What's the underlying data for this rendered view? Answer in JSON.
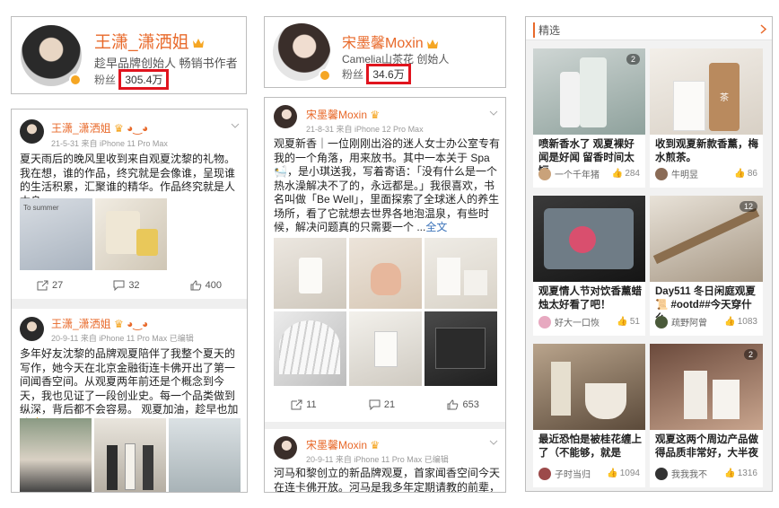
{
  "col1": {
    "profile": {
      "name": "王潇_潇洒姐",
      "subtitle": "趁早品牌创始人 畅销书作者",
      "fans_label": "粉丝",
      "fans_count": "305.4万"
    },
    "posts": [
      {
        "name": "王潇_潇洒姐",
        "meta": "21-5-31  来自 iPhone 11 Pro Max",
        "text": "夏天雨后的晚风里收到来自观夏沈黎的礼物。我在想，谁的作品，终究就是会像谁，呈现谁的生活积累，汇聚谁的精华。作品终究就是人本身。",
        "img_label": "To summer",
        "reposts": "27",
        "comments": "32",
        "likes": "400"
      },
      {
        "name": "王潇_潇洒姐",
        "meta": "20-9-11  来自 iPhone 11 Pro Max  已编辑",
        "text": "多年好友沈黎的品牌观夏陪伴了我整个夏天的写作，她今天在北京金融街连卡佛开出了第一间闻香空间。从观夏两年前还是个概念到今天，我也见证了一段创业史。每一个品类做到纵深，背后都不会容易。 观夏加油，趁早也加油🔆"
      }
    ]
  },
  "col2": {
    "profile": {
      "name": "宋墨馨Moxin",
      "subtitle": "Camelia山茶花 创始人",
      "fans_label": "粉丝",
      "fans_count": "34.6万"
    },
    "posts": [
      {
        "name": "宋墨馨Moxin",
        "meta": "21-8-31  来自 iPhone 12 Pro Max",
        "text": "观夏新香｜一位刚刚出浴的迷人女士办公室专有我的一个角落，用来放书。其中一本关于 Spa 🛀，是小琪送我，写着寄语：「没有什么是一个热水澡解决不了的，永远都是。」我很喜欢，书名叫做「Be Well」，里面探索了全球迷人的养生场所，看了它就想去世界各地泡温泉，有些时候，解决问题真的只需要一个 ...",
        "more": "全文",
        "reposts": "11",
        "comments": "21",
        "likes": "653"
      },
      {
        "name": "宋墨馨Moxin",
        "meta": "20-9-11  来自 iPhone 11 Pro Max  已编辑",
        "text": "河马和黎创立的新品牌观夏，首家闻香空间今天在连卡佛开放。河马是我多年定期请教的前辈，每个"
      }
    ]
  },
  "col3": {
    "header": "精选",
    "cards": [
      {
        "title": "喷新香水了 观夏裸好闻是好闻 留香时间太短",
        "author": "一个千年猪",
        "likes": "284",
        "img_count": "2"
      },
      {
        "title": "收到观夏新款香薰，梅水煎茶。",
        "author": "牛明昱",
        "likes": "86",
        "img_label": "茶"
      },
      {
        "title": "观夏情人节对饮香薰蜡烛太好看了吧！",
        "author": "好大一口恢",
        "likes": "51"
      },
      {
        "title": "Day511 冬日闲庭观夏📜 #ootd##今天穿什么",
        "author": "疏野阿曾",
        "likes": "1083",
        "img_count": "12"
      },
      {
        "title": "最近恐怕是被桂花缠上了（不能够，就是",
        "author": "子时当归",
        "likes": "1094"
      },
      {
        "title": "观夏这两个周边产品做得品质非常好，大半夜",
        "author": "我我我不",
        "likes": "1316",
        "img_count": "2"
      }
    ]
  }
}
